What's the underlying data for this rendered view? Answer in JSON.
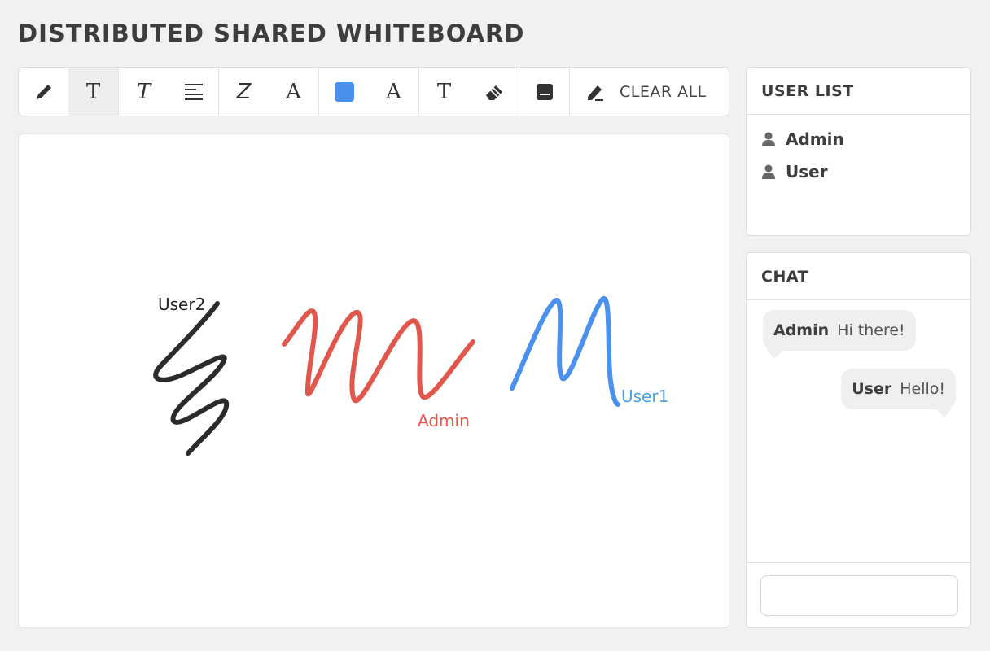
{
  "app": {
    "title": "DISTRIBUTED SHARED WHITEBOARD"
  },
  "toolbar": {
    "tools": [
      {
        "icon": "pencil-icon"
      },
      {
        "icon": "text-icon",
        "glyph": "T"
      },
      {
        "icon": "italic-text-icon",
        "glyph": "T"
      },
      {
        "icon": "align-icon"
      },
      {
        "icon": "zigzag-text-icon",
        "glyph": "Z"
      },
      {
        "icon": "font-icon",
        "glyph": "A"
      },
      {
        "icon": "color-swatch-icon",
        "color": "#4a90ee"
      },
      {
        "icon": "font-serif-icon",
        "glyph": "A"
      },
      {
        "icon": "text-serif-icon",
        "glyph": "T"
      },
      {
        "icon": "eraser-icon"
      },
      {
        "icon": "note-icon"
      },
      {
        "icon": "marker-icon"
      }
    ],
    "clear_label": "CLEAR ALL"
  },
  "canvas": {
    "strokes": [
      {
        "owner": "User2",
        "color": "#2b2b2b"
      },
      {
        "owner": "Admin",
        "color": "#e2574c"
      },
      {
        "owner": "User1",
        "color": "#4a90ee"
      }
    ],
    "labels": {
      "user2": {
        "text": "User2",
        "color": "#222222"
      },
      "admin": {
        "text": "Admin",
        "color": "#e2574c"
      },
      "user1": {
        "text": "User1",
        "color": "#4aa0e0"
      }
    }
  },
  "user_list": {
    "title": "USER LIST",
    "users": [
      "Admin",
      "User"
    ]
  },
  "chat": {
    "title": "CHAT",
    "messages": [
      {
        "sender": "Admin",
        "text": "Hi there!"
      },
      {
        "sender": "User",
        "text": "Hello!"
      }
    ],
    "input": {
      "value": "",
      "placeholder": ""
    }
  }
}
